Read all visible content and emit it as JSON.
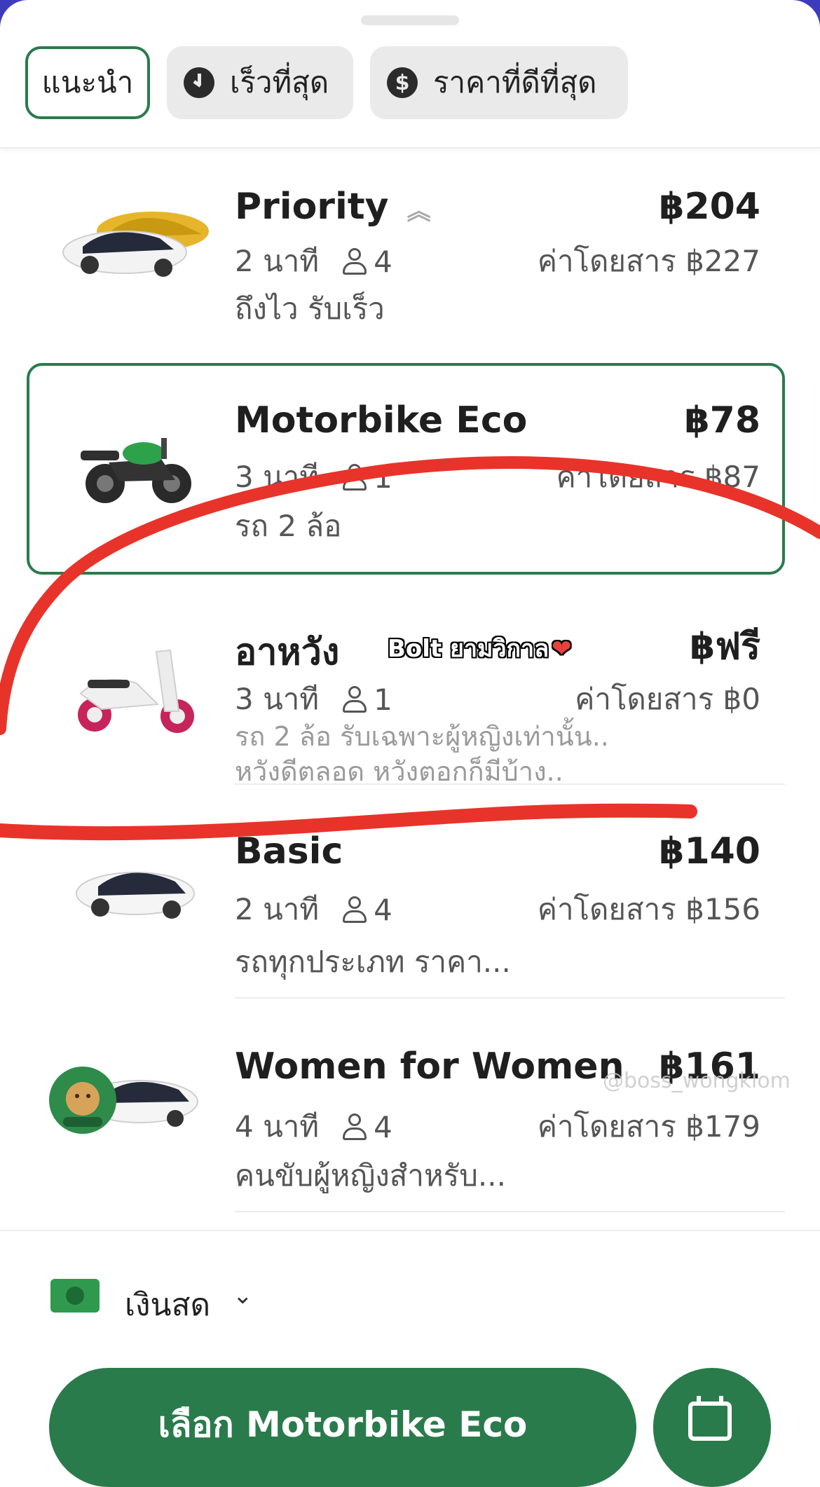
{
  "tabs": [
    {
      "label": "แนะนำ",
      "active": true
    },
    {
      "label": "เร็วที่สุด",
      "icon": "clock-icon"
    },
    {
      "label": "ราคาที่ดีที่สุด",
      "icon": "dollar-icon"
    }
  ],
  "rides": [
    {
      "title": "Priority",
      "price": "฿204",
      "eta": "2 นาที",
      "seats": "4",
      "fare": "ค่าโดยสาร ฿227",
      "desc": "ถึงไว รับเร็ว",
      "icon": "priority-chevrons-icon"
    },
    {
      "title": "Motorbike Eco",
      "price": "฿78",
      "eta": "3 นาที",
      "seats": "1",
      "fare": "ค่าโดยสาร ฿87",
      "desc": "รถ 2 ล้อ",
      "selected": true
    },
    {
      "title": "อาหวัง",
      "price": "฿ฟรี",
      "eta": "3 นาที",
      "seats": "1",
      "fare": "ค่าโดยสาร ฿0",
      "desc": "รถ 2 ล้อ รับเฉพาะผู้หญิงเท่านั้น..",
      "desc2": "หวังดีตลอด หวังตอกก็มีบ้าง.."
    },
    {
      "title": "Basic",
      "price": "฿140",
      "eta": "2 นาที",
      "seats": "4",
      "fare": "ค่าโดยสาร ฿156",
      "desc": "รถทุกประเภท ราคา..."
    },
    {
      "title": "Women for Women",
      "price": "฿161",
      "eta": "4 นาที",
      "seats": "4",
      "fare": "ค่าโดยสาร ฿179",
      "desc": "คนขับผู้หญิงสำหรับ..."
    }
  ],
  "overlay": {
    "sticker": "Bolt ยามวิกาล",
    "heart": "❤",
    "watermark": "@boss_wongklom"
  },
  "payment": {
    "label": "เงินสด",
    "chevron": "⌄"
  },
  "cta": {
    "label": "เลือก Motorbike Eco"
  },
  "colors": {
    "accent": "#2a7b4b",
    "annotation": "#e8332b"
  }
}
